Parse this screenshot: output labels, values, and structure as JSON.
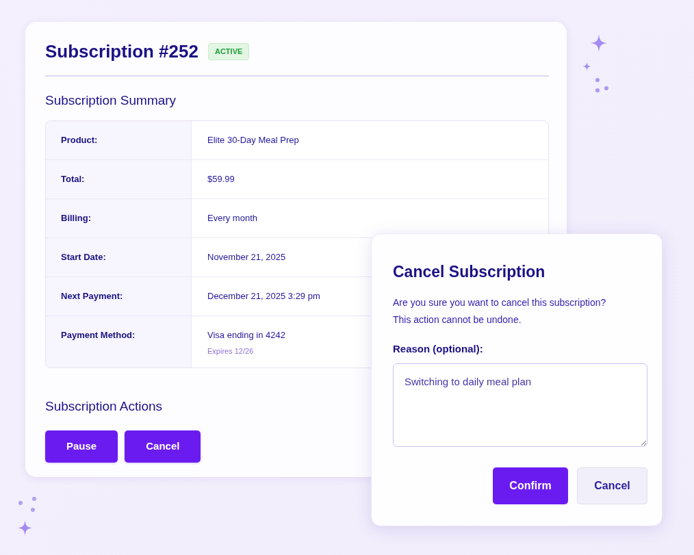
{
  "subscription": {
    "title": "Subscription #252",
    "status": {
      "label": "ACTIVE",
      "kind": "active"
    }
  },
  "summary": {
    "heading": "Subscription Summary",
    "rows": [
      {
        "label": "Product:",
        "value": "Elite 30-Day Meal Prep"
      },
      {
        "label": "Total:",
        "value": "$59.99"
      },
      {
        "label": "Billing:",
        "value": "Every month"
      },
      {
        "label": "Start Date:",
        "value": "November 21, 2025"
      },
      {
        "label": "Next Payment:",
        "value": "December 21, 2025 3:29 pm"
      },
      {
        "label": "Payment Method:",
        "value": "Visa ending in 4242",
        "note": "Expires 12/26"
      }
    ]
  },
  "actions": {
    "heading": "Subscription Actions",
    "buttons": [
      "Pause",
      "Cancel"
    ]
  },
  "dialog": {
    "title": "Cancel Subscription",
    "message": "Are you sure you want to cancel this subscription? This action cannot be undone.",
    "field": {
      "label": "Reason (optional):",
      "value": "Switching to daily meal plan"
    },
    "buttons": [
      {
        "label": "Confirm",
        "kind": "primary"
      },
      {
        "label": "Cancel",
        "kind": "secondary"
      }
    ]
  }
}
